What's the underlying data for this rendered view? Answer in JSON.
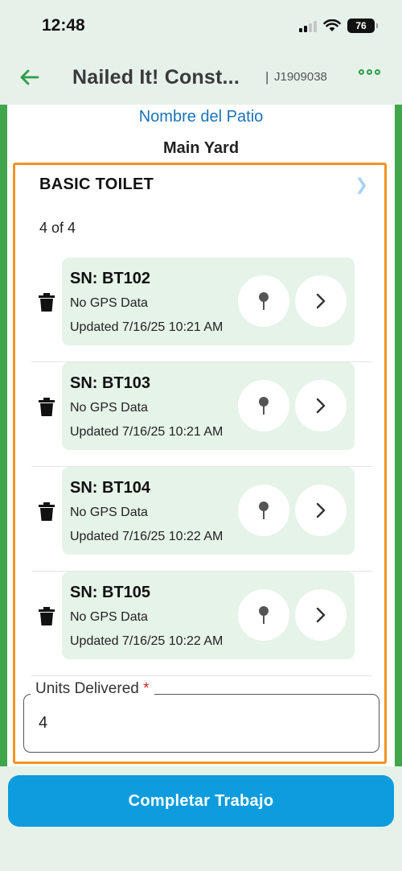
{
  "status_bar": {
    "time": "12:48",
    "battery": "76"
  },
  "header": {
    "title": "Nailed It! Const...",
    "separator": "|",
    "job_id": "J1909038"
  },
  "yard": {
    "label": "Nombre del Patio",
    "value": "Main Yard"
  },
  "section": {
    "title": "BASIC TOILET",
    "count": "4 of 4"
  },
  "units": [
    {
      "sn": "SN: BT102",
      "gps": "No GPS Data",
      "updated": "Updated 7/16/25 10:21 AM"
    },
    {
      "sn": "SN: BT103",
      "gps": "No GPS Data",
      "updated": "Updated 7/16/25 10:21 AM"
    },
    {
      "sn": "SN: BT104",
      "gps": "No GPS Data",
      "updated": "Updated 7/16/25 10:22 AM"
    },
    {
      "sn": "SN: BT105",
      "gps": "No GPS Data",
      "updated": "Updated 7/16/25 10:22 AM"
    }
  ],
  "units_delivered": {
    "label": "Units Delivered",
    "required_mark": "*",
    "value": "4"
  },
  "complete_button": {
    "label": "Completar Trabajo"
  },
  "colors": {
    "accent_green": "#3fa64a",
    "highlight_orange": "#f39221",
    "primary_blue": "#0d9cde",
    "link_blue": "#1a73b8"
  }
}
